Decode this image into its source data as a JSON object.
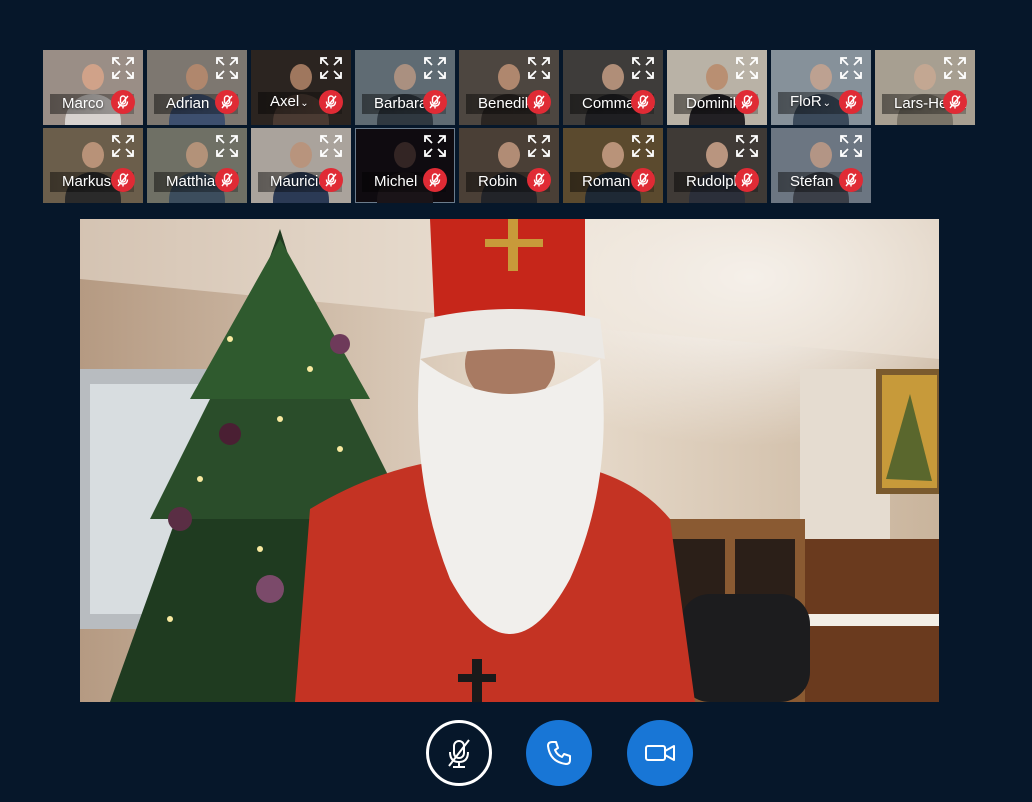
{
  "participants_row1": [
    {
      "name": "Marco",
      "dropdown": false,
      "muted": true,
      "bg": "#9a8e86",
      "shirt": "#d7d2cf",
      "skin": "#d9a68a"
    },
    {
      "name": "Adrian",
      "dropdown": false,
      "muted": true,
      "bg": "#7d7770",
      "shirt": "#3d4f6e",
      "skin": "#b88a6c"
    },
    {
      "name": "Axel",
      "dropdown": true,
      "muted": true,
      "bg": "#2b2420",
      "shirt": "#4a3a32",
      "skin": "#b4866a"
    },
    {
      "name": "Barbara",
      "dropdown": false,
      "muted": true,
      "bg": "#5f6b73",
      "shirt": "#2f3840",
      "skin": "#b79682"
    },
    {
      "name": "Benedikt",
      "dropdown": false,
      "muted": true,
      "bg": "#4d4640",
      "shirt": "#2a2522",
      "skin": "#c19377"
    },
    {
      "name": "Commander",
      "dropdown": false,
      "muted": true,
      "bg": "#3e3c3a",
      "shirt": "#1f1f22",
      "skin": "#c49c84"
    },
    {
      "name": "Dominik",
      "dropdown": false,
      "muted": true,
      "bg": "#b9b2a6",
      "shirt": "#222024",
      "skin": "#b98869"
    },
    {
      "name": "FloR",
      "dropdown": true,
      "muted": true,
      "bg": "#86919a",
      "shirt": "#3b4a5b",
      "skin": "#c7a38f"
    },
    {
      "name": "Lars-Hendrik",
      "dropdown": false,
      "muted": true,
      "bg": "#a79f91",
      "shirt": "#7a7468",
      "skin": "#c8a892"
    }
  ],
  "participants_row2": [
    {
      "name": "Markus",
      "dropdown": false,
      "muted": true,
      "bg": "#6b5e4b",
      "shirt": "#2a2a2a",
      "skin": "#c59b80"
    },
    {
      "name": "Matthias",
      "dropdown": false,
      "muted": true,
      "bg": "#6f7065",
      "shirt": "#3c4d5d",
      "skin": "#c0987c"
    },
    {
      "name": "Mauricio",
      "dropdown": false,
      "muted": true,
      "bg": "#aaa39c",
      "shirt": "#2b3a55",
      "skin": "#bb9278"
    },
    {
      "name": "Michel",
      "dropdown": false,
      "muted": true,
      "bg": "#0f0b10",
      "shirt": "#1a1418",
      "skin": "#3a2a28",
      "selected": true
    },
    {
      "name": "Robin",
      "dropdown": false,
      "muted": true,
      "bg": "#4a3f36",
      "shirt": "#222429",
      "skin": "#c39a80"
    },
    {
      "name": "Roman",
      "dropdown": false,
      "muted": true,
      "bg": "#5b4a2e",
      "shirt": "#1e2935",
      "skin": "#caa086"
    },
    {
      "name": "Rudolph",
      "dropdown": false,
      "muted": true,
      "bg": "#3f3a36",
      "shirt": "#2b2f3a",
      "skin": "#cfa68c"
    },
    {
      "name": "Stefan",
      "dropdown": false,
      "muted": true,
      "bg": "#6c7682",
      "shirt": "#3b3f48",
      "skin": "#c09b86"
    }
  ],
  "controls": {
    "mic_muted": true,
    "call_color": "#1876d6",
    "camera_color": "#1876d6",
    "mic_border_color": "#ffffff"
  },
  "icons": {
    "expand": "expand-icon",
    "tile_mute": "microphone-muted-icon",
    "mic": "microphone-off-icon",
    "call": "phone-icon",
    "camera": "video-camera-icon"
  },
  "colors": {
    "background": "#06172a",
    "mute_badge": "#e02b35",
    "accent": "#1876d6"
  }
}
